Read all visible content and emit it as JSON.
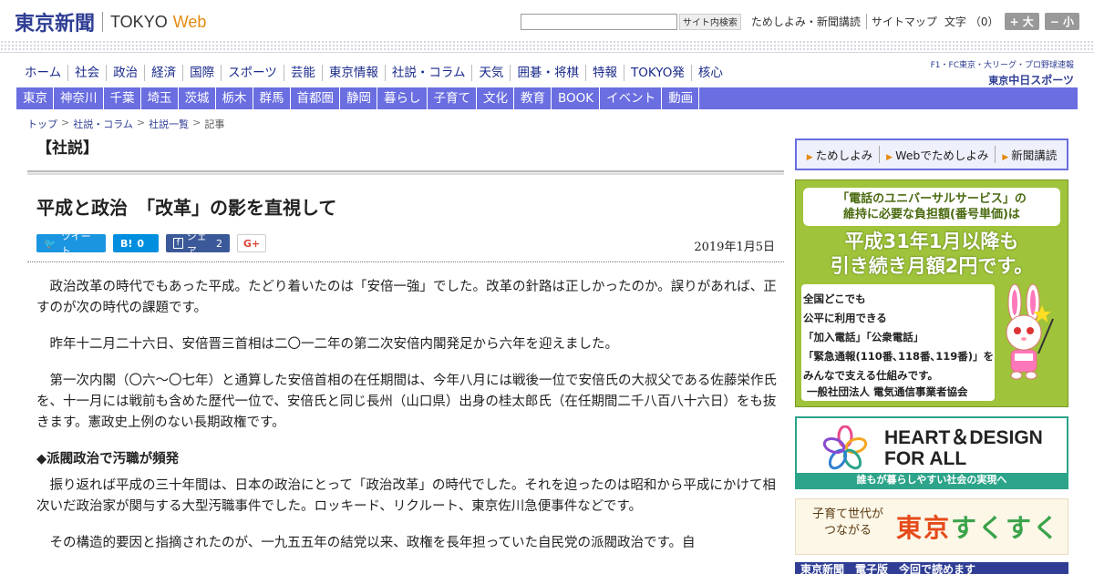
{
  "header": {
    "logo_jp": "東京新聞",
    "logo_en": "TOKYO",
    "logo_web": "Web",
    "search_button": "サイト内検索",
    "links": [
      "ためしよみ・新聞講読",
      "サイトマップ"
    ],
    "moji_label": "文字",
    "moji_count": "（0）",
    "size_up": "+ 大",
    "size_down": "− 小"
  },
  "main_nav": [
    "ホーム",
    "社会",
    "政治",
    "経済",
    "国際",
    "スポーツ",
    "芸能",
    "東京情報",
    "社説・コラム",
    "天気",
    "囲碁・将棋",
    "特報",
    "TOKYO発",
    "核心"
  ],
  "sports_logo": {
    "sub": "F1・FC東京・大リーグ・プロ野球速報",
    "main_prefix": "東京",
    "main": "中日スポーツ"
  },
  "region_nav": [
    "東京",
    "神奈川",
    "千葉",
    "埼玉",
    "茨城",
    "栃木",
    "群馬",
    "首都圏",
    "静岡",
    "暮らし",
    "子育て",
    "文化",
    "教育",
    "BOOK",
    "イベント",
    "動画"
  ],
  "breadcrumb": {
    "items": [
      "トップ",
      "社説・コラム",
      "社説一覧"
    ],
    "current": "記事",
    "sep": ">"
  },
  "article": {
    "category": "【社説】",
    "headline": "平成と政治　「改革」の影を直視して",
    "date": "2019年1月5日",
    "share": {
      "tweet": "ツイート",
      "hatena_label": "B!",
      "hatena_count": "0",
      "facebook_label": "シェア",
      "facebook_count": "2",
      "gplus": "G+"
    },
    "paragraphs": [
      "政治改革の時代でもあった平成。たどり着いたのは「安倍一強」でした。改革の針路は正しかったのか。誤りがあれば、正すのが次の時代の課題です。",
      "昨年十二月二十六日、安倍晋三首相は二〇一二年の第二次安倍内閣発足から六年を迎えました。",
      "第一次内閣（〇六～〇七年）と通算した安倍首相の在任期間は、今年八月には戦後一位で安倍氏の大叔父である佐藤栄作氏を、十一月には戦前も含めた歴代一位で、安倍氏と同じ長州（山口県）出身の桂太郎氏（在任期間二千八百八十六日）をも抜きます。憲政史上例のない長期政権です。"
    ],
    "subhead": "◆派閥政治で汚職が頻発",
    "paragraphs2": [
      "振り返れば平成の三十年間は、日本の政治にとって「政治改革」の時代でした。それを迫ったのは昭和から平成にかけて相次いだ政治家が関与する大型汚職事件でした。ロッキード、リクルート、東京佐川急便事件などです。",
      "その構造的要因と指摘されたのが、一九五五年の結党以来、政権を長年担っていた自民党の派閥政治です。自"
    ]
  },
  "sidebar": {
    "buttons": [
      "ためしよみ",
      "Webでためしよみ",
      "新聞講読"
    ],
    "ad_universal": {
      "title_line1": "「電話のユニバーサルサービス」の",
      "title_line2": "維持に必要な負担額(番号単価)は",
      "big_line1": "平成31年1月以降も",
      "big_line2": "引き続き月額2円です。",
      "body_lines": [
        "全国どこでも",
        "公平に利用できる",
        "「加入電話」「公衆電話」",
        "「緊急通報(110番､118番､119番)」を",
        "みんなで支える仕組みです。"
      ],
      "footer": "一般社団法人 電気通信事業者協会"
    },
    "ad_heart": {
      "line1": "HEART＆DESIGN",
      "line2": "FOR ALL",
      "band": "誰もが暮らしやすい社会の実現へ"
    },
    "ad_sukusuku": {
      "small_line1": "子育て世代が",
      "small_line2": "つながる",
      "big_prefix": "東京",
      "big": "すくすく"
    },
    "ad_bottom": "東京新聞　電子版　今回で読めます"
  },
  "colors": {
    "brand_blue": "#2f3e94",
    "nav_purple": "#6a6ee0",
    "accent_orange": "#e48a10"
  }
}
